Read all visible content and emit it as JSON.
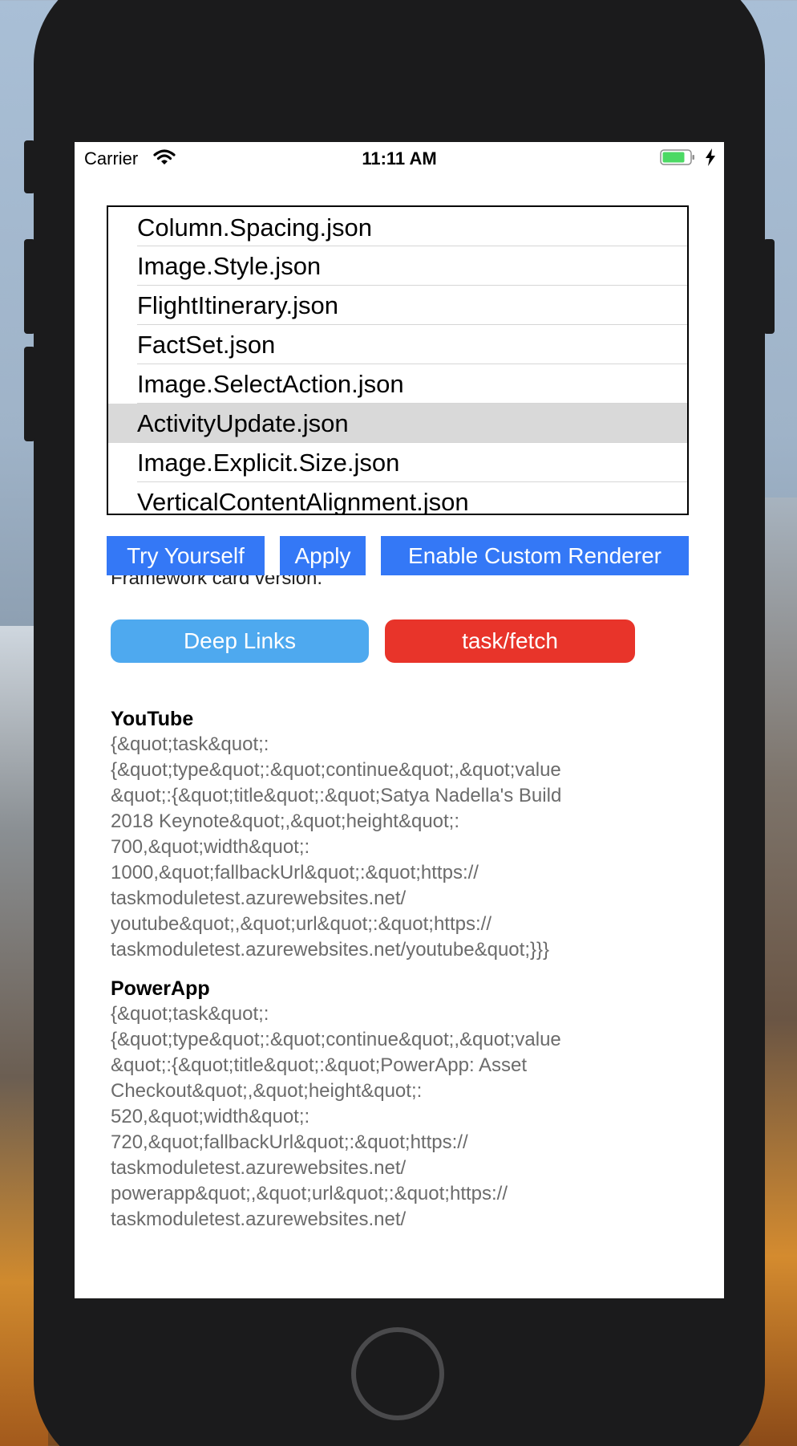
{
  "status_bar": {
    "carrier": "Carrier",
    "time": "11:11 AM",
    "battery_color": "#4cd964"
  },
  "file_list": {
    "items": [
      "Column.Spacing.json",
      "Image.Style.json",
      "FlightItinerary.json",
      "FactSet.json",
      "Image.SelectAction.json",
      "ActivityUpdate.json",
      "Image.Explicit.Size.json",
      "VerticalContentAlignment.json"
    ],
    "selected_item": "ActivityUpdate.json"
  },
  "toolbar": {
    "try_yourself": "Try Yourself",
    "apply": "Apply",
    "enable_custom_renderer": "Enable Custom Renderer",
    "button_color": "#3478f6"
  },
  "card": {
    "clipped_text": "Framework card version.",
    "deep_links": "Deep Links",
    "task_fetch": "task/fetch",
    "deep_links_color": "#4ea9ef",
    "task_fetch_color": "#e8342a",
    "sections": [
      {
        "title": "YouTube",
        "body": "{&quot;task&quot;:\n{&quot;type&quot;:&quot;continue&quot;,&quot;value\n&quot;:{&quot;title&quot;:&quot;Satya Nadella's Build\n2018 Keynote&quot;,&quot;height&quot;:\n700,&quot;width&quot;:\n1000,&quot;fallbackUrl&quot;:&quot;https://\ntaskmoduletest.azurewebsites.net/\nyoutube&quot;,&quot;url&quot;:&quot;https://\ntaskmoduletest.azurewebsites.net/youtube&quot;}}}"
      },
      {
        "title": "PowerApp",
        "body": "{&quot;task&quot;:\n{&quot;type&quot;:&quot;continue&quot;,&quot;value\n&quot;:{&quot;title&quot;:&quot;PowerApp: Asset\nCheckout&quot;,&quot;height&quot;:\n520,&quot;width&quot;:\n720,&quot;fallbackUrl&quot;:&quot;https://\ntaskmoduletest.azurewebsites.net/\npowerapp&quot;,&quot;url&quot;:&quot;https://\ntaskmoduletest.azurewebsites.net/"
      }
    ]
  }
}
